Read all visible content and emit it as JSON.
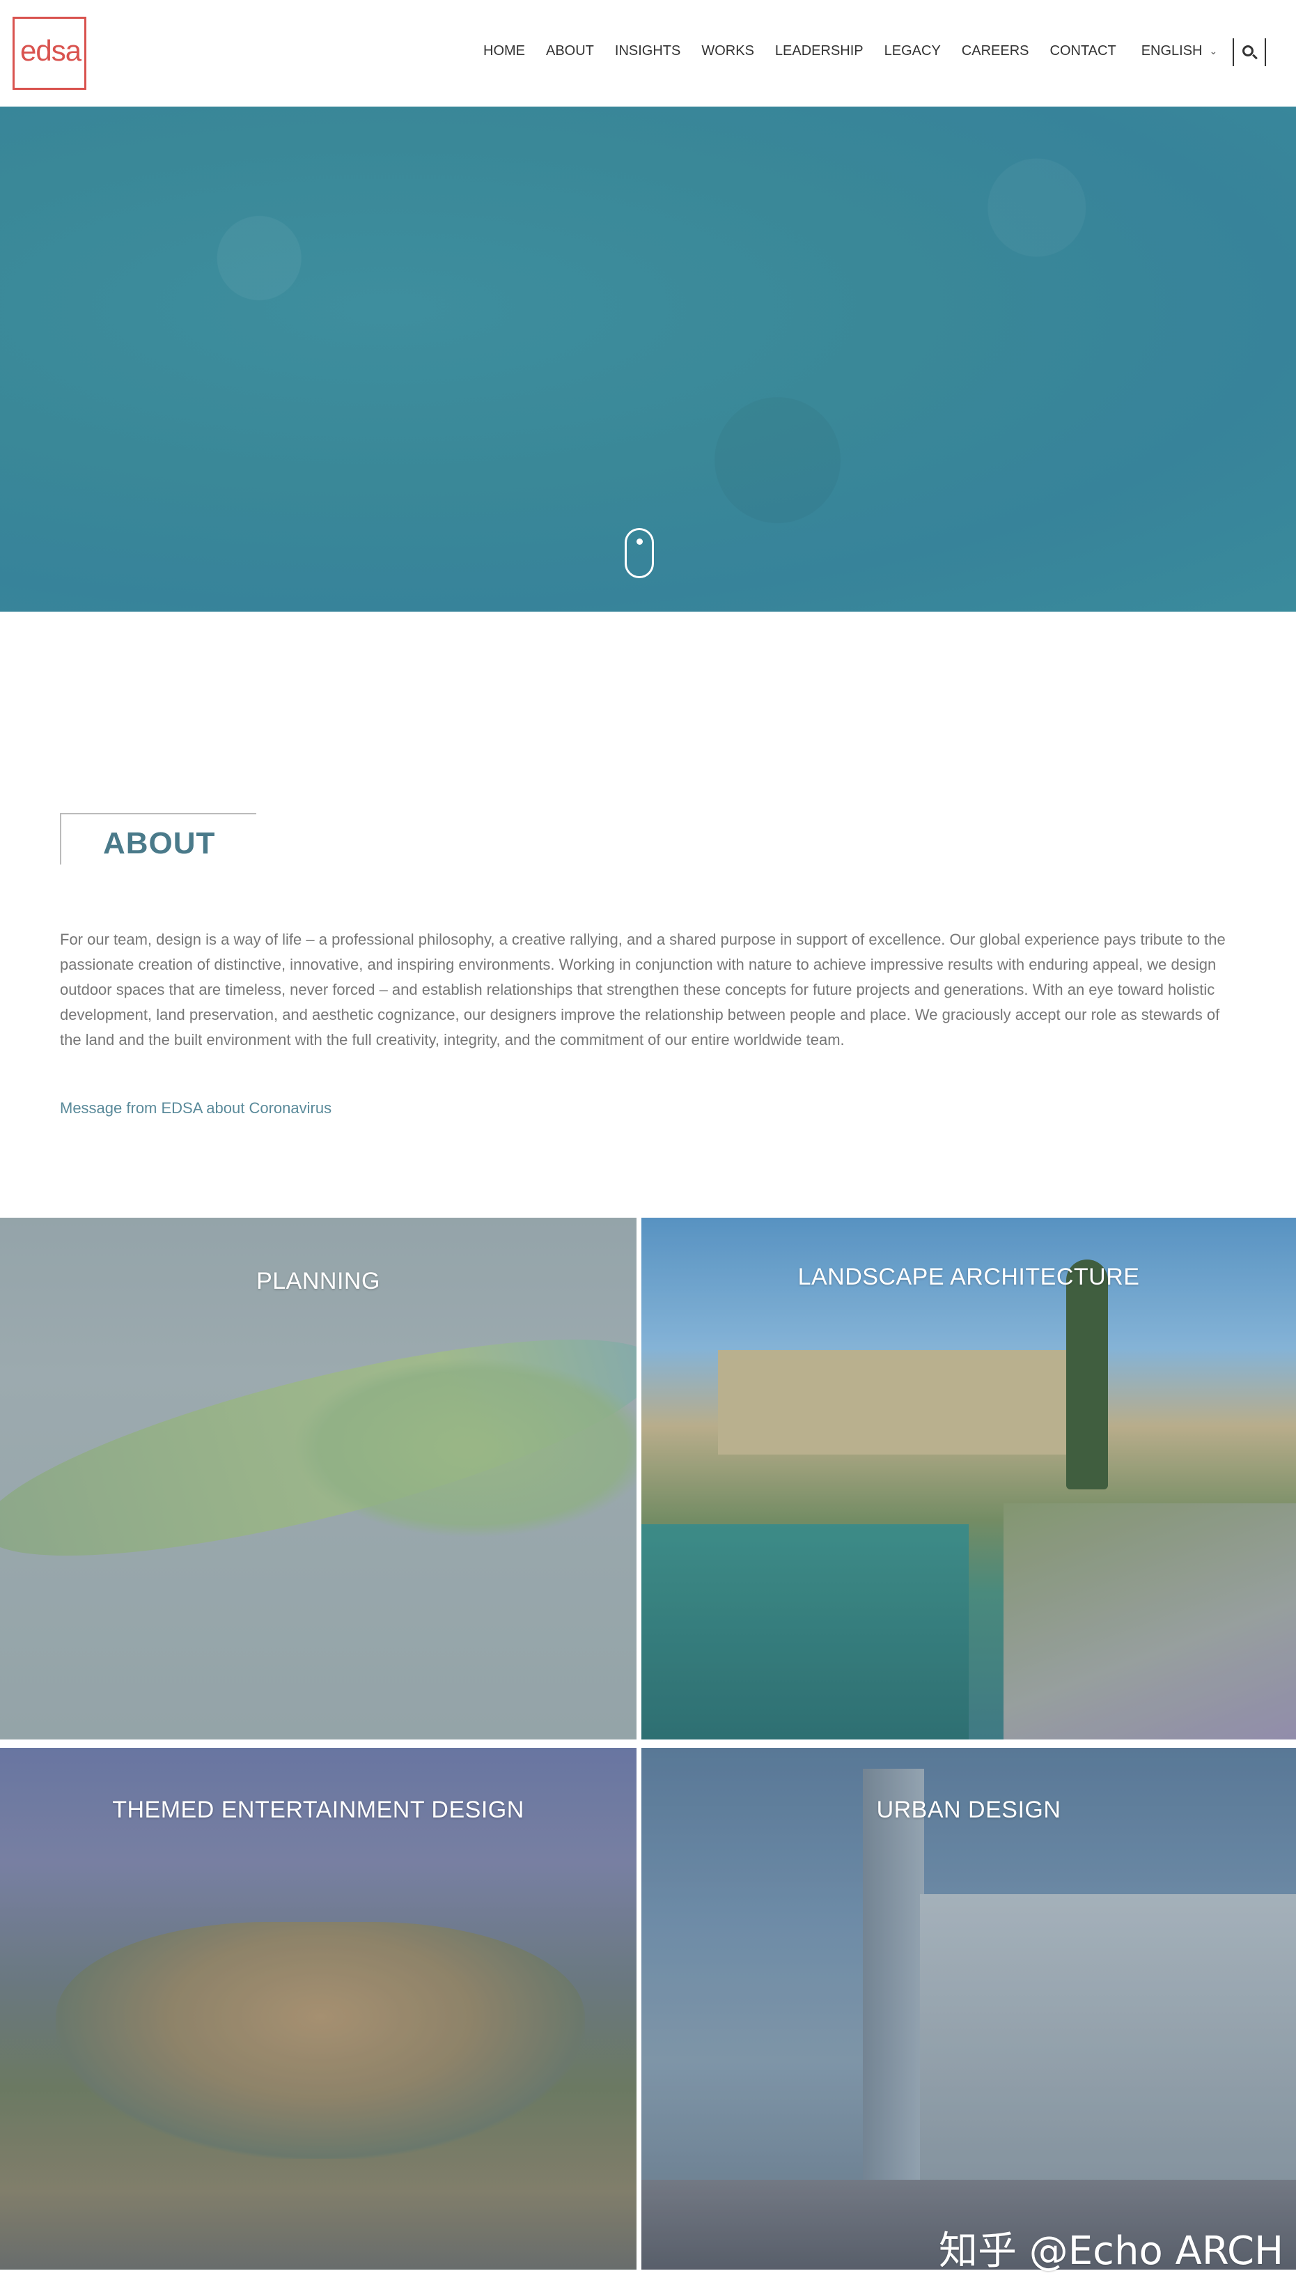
{
  "header": {
    "logo_text": "edsa",
    "nav": [
      "HOME",
      "ABOUT",
      "INSIGHTS",
      "WORKS",
      "LEADERSHIP",
      "LEGACY",
      "CAREERS",
      "CONTACT"
    ],
    "language": "ENGLISH"
  },
  "about": {
    "title": "ABOUT",
    "body": "For our team, design is a way of life – a professional philosophy, a creative rallying, and a shared purpose in support of excellence. Our global experience pays tribute to the passionate creation of distinctive, innovative, and inspiring environments. Working in conjunction with nature to achieve impressive results with enduring appeal, we design outdoor spaces that are timeless, never forced – and establish relationships that strengthen these concepts for future projects and generations. With an eye toward holistic development, land preservation, and aesthetic cognizance, our designers improve the relationship between people and place. We graciously accept our role as stewards of the land and the built environment with the full creativity, integrity, and the commitment of our entire worldwide team.",
    "link": "Message from EDSA about Coronavirus"
  },
  "tiles": [
    {
      "title": "PLANNING"
    },
    {
      "title": "LANDSCAPE ARCHITECTURE"
    },
    {
      "title": "THEMED ENTERTAINMENT DESIGN"
    },
    {
      "title": "URBAN DESIGN"
    }
  ],
  "watermark": "知乎 @Echo ARCH",
  "colors": {
    "logo": "#d9534f",
    "hero": "#3a8898",
    "about_title": "#4a7a8a"
  }
}
